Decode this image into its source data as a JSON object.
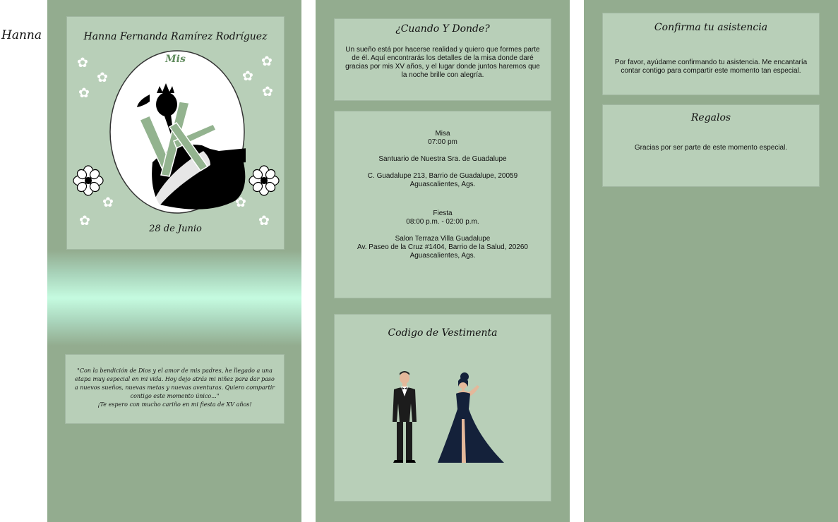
{
  "side_label": "Hanna",
  "cover": {
    "name": "Hanna Fernanda Ramírez Rodríguez",
    "monogram_word": "Mis",
    "monogram_numeral": "XV",
    "date": "28 de Junio"
  },
  "quote": {
    "text": "\"Con la bendición de Dios y el amor de mis padres, he llegado a una etapa muy especial en mi vida. Hoy dejo atrás mi niñez para dar paso a nuevos sueños, nuevas metas y nuevas aventuras. Quiero compartir contigo este momento único...\"",
    "closing": "¡Te espero con mucho cariño en mi fiesta de XV años!"
  },
  "where": {
    "title": "¿Cuando Y Donde?",
    "text": "Un sueño está por hacerse realidad y quiero que formes parte de él. Aquí encontrarás los detalles de la misa donde daré gracias por mis XV años, y el lugar donde juntos haremos que la noche brille con alegría."
  },
  "events": {
    "mass": {
      "label": "Misa",
      "time": "07:00 pm",
      "venue": "Santuario de Nuestra Sra. de Guadalupe",
      "address_line1": "C. Guadalupe 213, Barrio de Guadalupe, 20059",
      "address_line2": "Aguascalientes, Ags."
    },
    "party": {
      "label": "Fiesta",
      "time": "08:00 p.m. - 02:00 p.m.",
      "venue": "Salon Terraza Villa Guadalupe",
      "address_line1": "Av. Paseo de la Cruz #1404, Barrio de la Salud, 20260",
      "address_line2": "Aguascalientes, Ags."
    }
  },
  "dress_code": {
    "title": "Codigo de Vestimenta"
  },
  "rsvp": {
    "title": "Confirma tu asistencia",
    "text": "Por favor, ayúdame confirmando tu asistencia. Me encantaría contar contigo para compartir este momento tan especial."
  },
  "gifts": {
    "title": "Regalos",
    "text": "Gracias por ser parte de este momento especial."
  },
  "colors": {
    "page": "#ffffff",
    "column": "#93ac8f",
    "card": "#b8cfb8",
    "glow": "#c5fbe0",
    "accent_green": "#93b38f",
    "silhouette": "#000000",
    "outfit": "#14213a"
  }
}
